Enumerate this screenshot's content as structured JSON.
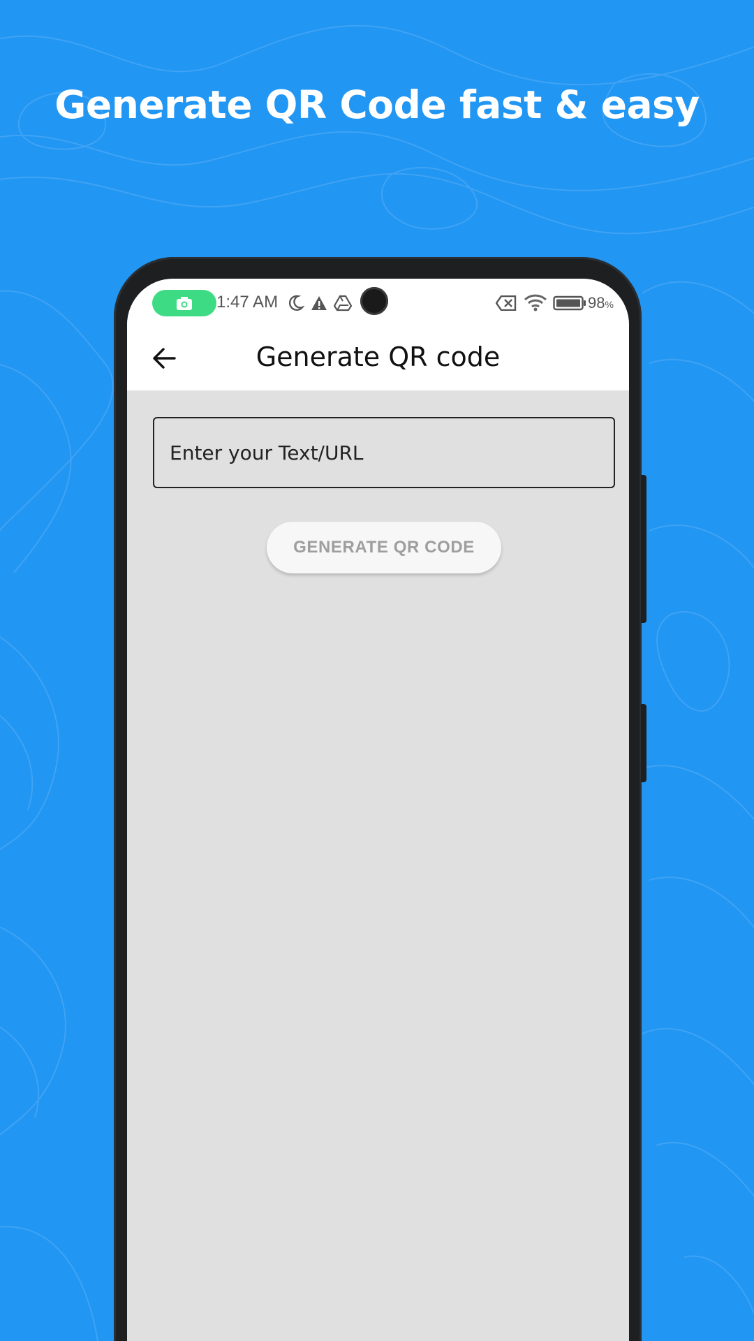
{
  "promo": {
    "headline": "Generate QR Code fast & easy",
    "background_color": "#2196f3"
  },
  "status_bar": {
    "time": "1:47 AM",
    "battery_percent": "98",
    "battery_unit": "%",
    "icons": [
      "screen-record-icon",
      "moon-icon",
      "warning-icon",
      "drive-icon",
      "no-sim-icon",
      "wifi-icon",
      "battery-icon"
    ],
    "record_pill_color": "#3ddc84"
  },
  "app_bar": {
    "title": "Generate QR code",
    "back_icon": "arrow-left-icon"
  },
  "form": {
    "input_placeholder": "Enter your Text/URL",
    "input_value": "",
    "button_label": "GENERATE QR CODE"
  }
}
